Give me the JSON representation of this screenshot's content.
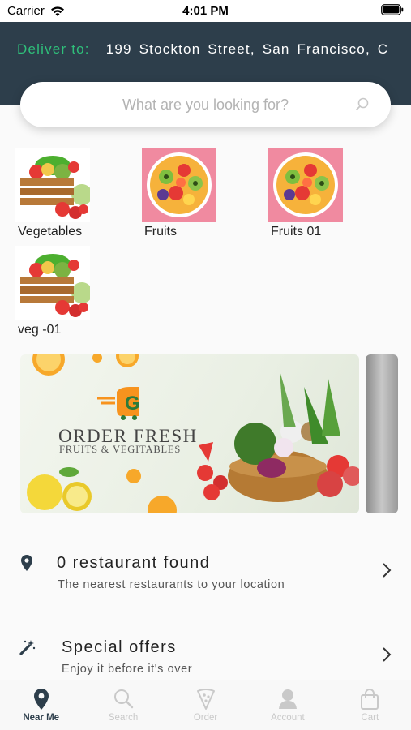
{
  "status_bar": {
    "carrier": "Carrier",
    "time": "4:01 PM"
  },
  "header": {
    "deliver_label": "Deliver to:",
    "address": "199 Stockton Street, San Francisco, C"
  },
  "search": {
    "placeholder": "What are you looking for?"
  },
  "categories": [
    {
      "label": "Vegetables",
      "image": "vegetables-crate"
    },
    {
      "label": "Fruits",
      "image": "fruit-bowl"
    },
    {
      "label": "Fruits  01",
      "image": "fruit-bowl"
    },
    {
      "label": "veg  -01",
      "image": "vegetables-crate"
    }
  ],
  "banner": {
    "brand_letter": "G",
    "title": "ORDER FRESH",
    "subtitle": "FRUITS & VEGITABLES"
  },
  "rows": [
    {
      "title": "0  restaurant  found",
      "subtitle": "The  nearest  restaurants  to  your  location",
      "icon": "location-pin-icon"
    },
    {
      "title": "Special  offers",
      "subtitle": "Enjoy  it  before  it's  over",
      "icon": "magic-wand-icon"
    }
  ],
  "tabs": [
    {
      "label": "Near Me",
      "icon": "location-pin-icon",
      "active": true
    },
    {
      "label": "Search",
      "icon": "search-icon",
      "active": false
    },
    {
      "label": "Order",
      "icon": "pizza-slice-icon",
      "active": false
    },
    {
      "label": "Account",
      "icon": "person-icon",
      "active": false
    },
    {
      "label": "Cart",
      "icon": "shopping-bag-icon",
      "active": false
    }
  ],
  "colors": {
    "header_bg": "#2d3e4b",
    "deliver_label": "#2fbf7a",
    "active_tab": "#2d3e4b",
    "inactive_tab": "#c9c9c9"
  }
}
